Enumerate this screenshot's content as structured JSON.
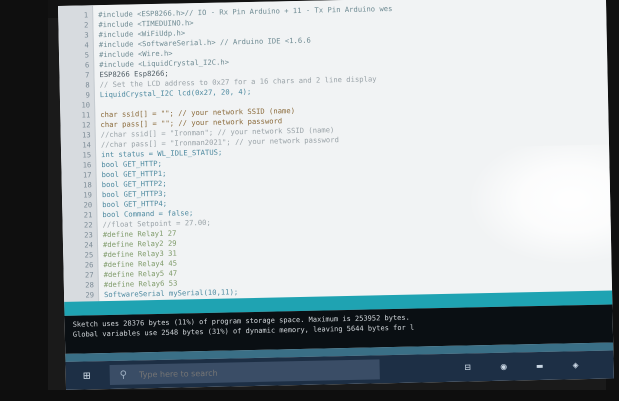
{
  "editor": {
    "lines": [
      {
        "num": "1",
        "text": "#include <ESP8266.h>// IO - Rx Pin Arduino + 11 - Tx Pin Arduino wes",
        "style": "kw-include"
      },
      {
        "num": "2",
        "text": "#include <TIMEDUINO.h>",
        "style": "kw-include"
      },
      {
        "num": "3",
        "text": "#include <WiFiUdp.h>",
        "style": "kw-include"
      },
      {
        "num": "4",
        "text": "#include <SoftwareSerial.h> // Arduino IDE <1.6.6",
        "style": "kw-include"
      },
      {
        "num": "5",
        "text": "#include <Wire.h>",
        "style": "kw-include"
      },
      {
        "num": "6",
        "text": "#include <LiquidCrystal_I2C.h>",
        "style": "kw-include"
      },
      {
        "num": "7",
        "text": "ESP8266 Esp8266;",
        "style": "plain"
      },
      {
        "num": "8",
        "text": "// Set the LCD address to 0x27 for a 16 chars and 2 line display",
        "style": "cmt"
      },
      {
        "num": "9",
        "text": "LiquidCrystal_I2C lcd(0x27, 20, 4);",
        "style": "kw-type"
      },
      {
        "num": "10",
        "text": "",
        "style": "plain"
      },
      {
        "num": "11",
        "text": "char ssid[] = \"\";          // your network SSID (name)",
        "style": "str"
      },
      {
        "num": "12",
        "text": "char pass[] = \"\";       // your network password",
        "style": "str"
      },
      {
        "num": "13",
        "text": "//char ssid[] = \"Ironman\";              // your network SSID (name)",
        "style": "cmt"
      },
      {
        "num": "14",
        "text": "//char pass[] = \"Ironman2021\";          // your network password",
        "style": "cmt"
      },
      {
        "num": "15",
        "text": "int status = WL_IDLE_STATUS;",
        "style": "kw-type"
      },
      {
        "num": "16",
        "text": "bool GET_HTTP;",
        "style": "kw-type"
      },
      {
        "num": "17",
        "text": "bool GET_HTTP1;",
        "style": "kw-type"
      },
      {
        "num": "18",
        "text": "bool GET_HTTP2;",
        "style": "kw-type"
      },
      {
        "num": "19",
        "text": "bool GET_HTTP3;",
        "style": "kw-type"
      },
      {
        "num": "20",
        "text": "bool GET_HTTP4;",
        "style": "kw-type"
      },
      {
        "num": "21",
        "text": "bool Command = false;",
        "style": "kw-type"
      },
      {
        "num": "22",
        "text": "//float Setpoint = 27.00;",
        "style": "cmt"
      },
      {
        "num": "23",
        "text": "#define Relay1 27",
        "style": "kw-define"
      },
      {
        "num": "24",
        "text": "#define Relay2 29",
        "style": "kw-define"
      },
      {
        "num": "25",
        "text": "#define Relay3 31",
        "style": "kw-define"
      },
      {
        "num": "26",
        "text": "#define Relay4 45",
        "style": "kw-define"
      },
      {
        "num": "27",
        "text": "#define Relay5 47",
        "style": "kw-define"
      },
      {
        "num": "28",
        "text": "#define Relay6 53",
        "style": "kw-define"
      },
      {
        "num": "29",
        "text": "SoftwareSerial mySerial(10,11);",
        "style": "kw-type"
      }
    ]
  },
  "console": {
    "lines": [
      "Sketch uses 28376 bytes (11%) of program storage space. Maximum is 253952 bytes.",
      "Global variables use 2548 bytes (31%) of dynamic memory, leaving 5644 bytes for l"
    ]
  },
  "taskbar": {
    "start_glyph": "⊞",
    "search_placeholder": "Type here to search",
    "search_glyph": "⚲",
    "icons": [
      "⊟",
      "◉",
      "▬",
      "◈"
    ]
  }
}
